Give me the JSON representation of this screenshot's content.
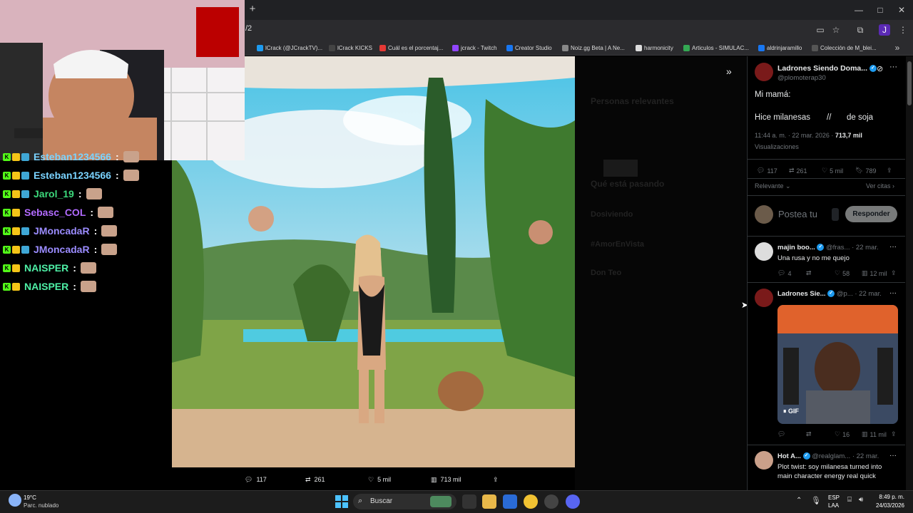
{
  "browser": {
    "new_tab_label": "+",
    "url": "/2",
    "window_controls": {
      "minimize": "—",
      "maximize": "□",
      "close": "✕"
    },
    "bookmarks": [
      {
        "label": "lCrack (@JCrackTV)...",
        "color": "#1d9bf0"
      },
      {
        "label": "lCrack KICKS",
        "color": "#444"
      },
      {
        "label": "Cuál es el porcentaj...",
        "color": "#e53935"
      },
      {
        "label": "jcrack - Twitch",
        "color": "#9146ff"
      },
      {
        "label": "Creator Studio",
        "color": "#1877f2"
      },
      {
        "label": "Noiz.gg Beta | A Ne...",
        "color": "#888"
      },
      {
        "label": "harmonicity",
        "color": "#ddd"
      },
      {
        "label": "Articulos - SIMULAC...",
        "color": "#34a853"
      },
      {
        "label": "aldrinjaramillo",
        "color": "#1877f2"
      },
      {
        "label": "Colección de M_blei...",
        "color": "#555"
      }
    ]
  },
  "chat": [
    {
      "user": "Esteban1234566",
      "sep": ":",
      "color": "#7ad3ff"
    },
    {
      "user": "Esteban1234566",
      "sep": ":",
      "color": "#7ad3ff"
    },
    {
      "user": "Jarol_19",
      "sep": ":",
      "color": "#3cd97b"
    },
    {
      "user": "Sebasc_COL",
      "sep": ":",
      "color": "#b26bff"
    },
    {
      "user": "JMoncadaR",
      "sep": ":",
      "color": "#9b8cff"
    },
    {
      "user": "JMoncadaR",
      "sep": ":",
      "color": "#9b8cff"
    },
    {
      "user": "NAISPER",
      "sep": ":",
      "color": "#4ef0a6"
    },
    {
      "user": "NAISPER",
      "sep": ":",
      "color": "#4ef0a6"
    }
  ],
  "media_actions": {
    "replies": "117",
    "reposts": "261",
    "likes": "5 mil",
    "views": "713 mil"
  },
  "post": {
    "author_name": "Ladrones Siendo Doma...",
    "handle": "@plomoterap30",
    "line1": "Mi mamá:",
    "line2_a": "Hice milanesas",
    "line2_b": "//",
    "line2_c": "de soja",
    "timestamp": "11:44 a. m. · 22 mar. 2026 ·",
    "views_count": "713,7 mil",
    "views_label": "Visualizaciones",
    "stats": {
      "replies": "117",
      "reposts": "261",
      "likes": "5 mil",
      "bookmarks": "789"
    },
    "sort_label": "Relevante",
    "quotes_label": "Ver citas",
    "reply_placeholder": "Postea tu",
    "reply_button": "Responder"
  },
  "replies": [
    {
      "name": "majin boo...",
      "handle": "@fras...",
      "date": "· 22 mar.",
      "text": "Una rusa y no me quejo",
      "stats": {
        "replies": "4",
        "reposts": "",
        "likes": "58",
        "views": "12 mil"
      }
    },
    {
      "name": "Ladrones Sie...",
      "handle": "@p...",
      "date": "· 22 mar.",
      "gif_label": "GIF",
      "stats": {
        "replies": "",
        "reposts": "",
        "likes": "16",
        "views": "11 mil"
      }
    },
    {
      "name": "Hot A...",
      "handle": "@realglam...",
      "date": "· 22 mar.",
      "text_line1": "Plot twist: soy milanesa turned into",
      "text_line2": "main character energy real quick"
    }
  ],
  "dim_column": {
    "relevant_people": "Personas relevantes",
    "whats_happening": "Qué está pasando",
    "trend1": "Dosiviendo",
    "trend2": "#AmorEnVista",
    "trend3": "Don Teo"
  },
  "taskbar": {
    "weather_temp": "19°C",
    "weather_desc": "Parc. nublado",
    "search_placeholder": "Buscar",
    "lang": "ESP",
    "lang_sub": "LAA",
    "time": "8:49 p. m.",
    "date": "24/03/2026"
  }
}
